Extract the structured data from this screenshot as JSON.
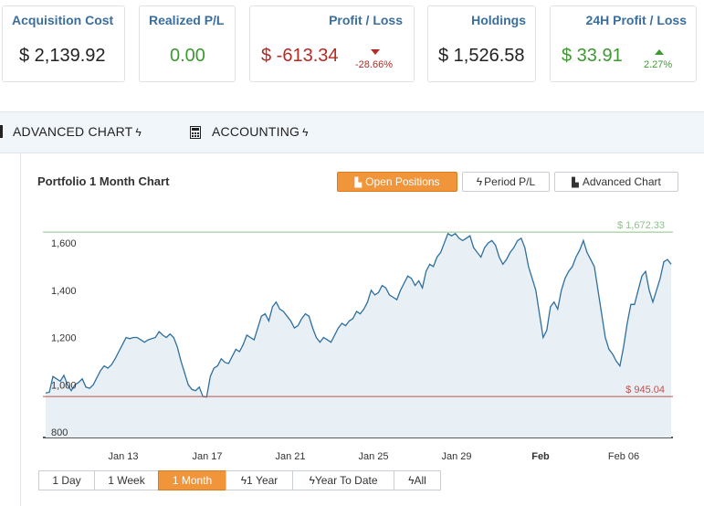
{
  "stats": [
    {
      "title": "Acquisition Cost",
      "value": "$ 2,139.92"
    },
    {
      "title": "Realized P/L",
      "value": "0.00"
    },
    {
      "title": "Profit / Loss",
      "value": "$ -613.34",
      "delta": "-28.66%"
    },
    {
      "title": "Holdings",
      "value": "$ 1,526.58"
    },
    {
      "title": "24H Profit / Loss",
      "value": "$ 33.91",
      "delta": "2.27%"
    }
  ],
  "tabs": [
    {
      "label": "ADVANCED CHART",
      "icon": "bolt-icon"
    },
    {
      "label": "ACCOUNTING",
      "icon": "bolt-icon"
    }
  ],
  "chart_panel": {
    "title": "Portfolio 1 Month Chart",
    "buttons": [
      "Open Positions",
      "Period P/L",
      "Advanced Chart"
    ],
    "active_button": "Open Positions"
  },
  "ranges": {
    "items": [
      "1 Day",
      "1 Week",
      "1 Month",
      "1 Year",
      "Year To Date",
      "All"
    ],
    "active": "1 Month"
  },
  "colors": {
    "accent": "#f0953a",
    "line": "#2f6f9e",
    "fill": "#e8f0f6",
    "max_line": "#8cc28a",
    "min_line": "#c0504d"
  },
  "chart_data": {
    "type": "area",
    "y_ticks": [
      "800",
      "1,000",
      "1,200",
      "1,400",
      "1,600"
    ],
    "x_ticks": [
      "Jan 13",
      "Jan 17",
      "Jan 21",
      "Jan 25",
      "Jan 29",
      "Feb",
      "Feb 06"
    ],
    "ylim": [
      800,
      1660
    ],
    "max_label": "$ 1,672.33",
    "min_label": "$ 945.04",
    "max_value": 1646,
    "min_value": 952,
    "x_start": "2020-01-10",
    "x_end": "2020-02-09",
    "series": [
      {
        "values": [
          965,
          968,
          1035,
          1025,
          1015,
          1040,
          1000,
          975,
          1000,
          1010,
          1025,
          990,
          985,
          1000,
          1030,
          1060,
          1080,
          1070,
          1085,
          1110,
          1140,
          1170,
          1200,
          1195,
          1200,
          1200,
          1190,
          1180,
          1190,
          1195,
          1200,
          1225,
          1210,
          1200,
          1215,
          1200,
          1160,
          1100,
          1050,
          1000,
          980,
          975,
          990,
          950,
          948,
          1035,
          1070,
          1080,
          1110,
          1095,
          1090,
          1120,
          1150,
          1140,
          1170,
          1210,
          1200,
          1190,
          1240,
          1290,
          1300,
          1270,
          1330,
          1350,
          1320,
          1310,
          1290,
          1270,
          1240,
          1250,
          1280,
          1300,
          1290,
          1240,
          1200,
          1180,
          1200,
          1190,
          1180,
          1210,
          1240,
          1260,
          1250,
          1270,
          1280,
          1310,
          1300,
          1320,
          1350,
          1400,
          1380,
          1390,
          1420,
          1410,
          1380,
          1370,
          1360,
          1400,
          1430,
          1460,
          1450,
          1420,
          1440,
          1410,
          1480,
          1510,
          1500,
          1540,
          1560,
          1600,
          1640,
          1630,
          1640,
          1620,
          1610,
          1620,
          1630,
          1580,
          1560,
          1540,
          1580,
          1600,
          1610,
          1590,
          1540,
          1510,
          1530,
          1560,
          1580,
          1610,
          1620,
          1580,
          1500,
          1450,
          1400,
          1300,
          1200,
          1230,
          1330,
          1350,
          1320,
          1400,
          1450,
          1480,
          1500,
          1540,
          1570,
          1610,
          1560,
          1530,
          1500,
          1400,
          1300,
          1200,
          1150,
          1130,
          1100,
          1080,
          1160,
          1260,
          1340,
          1340,
          1400,
          1460,
          1480,
          1400,
          1350,
          1400,
          1450,
          1520,
          1530,
          1510
        ]
      }
    ]
  }
}
